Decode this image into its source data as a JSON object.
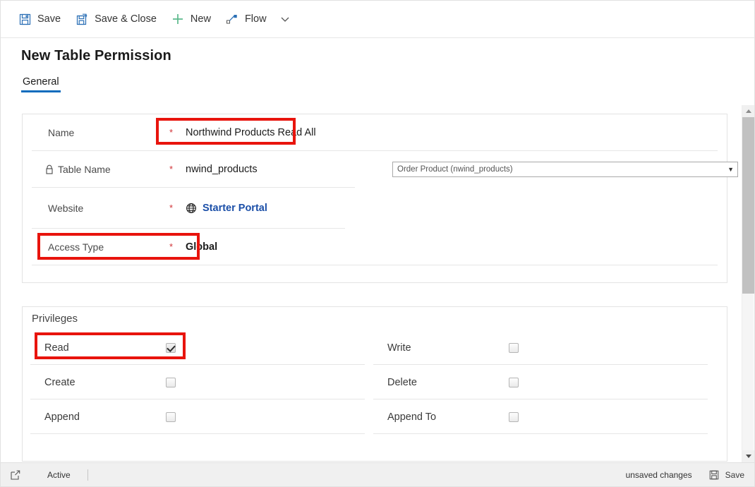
{
  "commandbar": {
    "items": [
      {
        "label": "Save",
        "icon": "save-icon"
      },
      {
        "label": "Save & Close",
        "icon": "save-and-close-icon"
      },
      {
        "label": "New",
        "icon": "plus-icon"
      },
      {
        "label": "Flow",
        "icon": "flow-icon"
      }
    ],
    "overflow_icon": "chevron-down-icon"
  },
  "page": {
    "title": "New Table Permission",
    "tabs": [
      {
        "label": "General",
        "active": true
      }
    ]
  },
  "general": {
    "rows": [
      {
        "label": "Name",
        "required": "*",
        "value": "Northwind Products Read All",
        "lock_icon": false,
        "bold": false,
        "highlighted": true
      },
      {
        "label": "Table Name",
        "required": "*",
        "value": "nwind_products",
        "lock_icon": true,
        "bold": false,
        "highlighted": false,
        "lookup": {
          "value": "Order Product (nwind_products)",
          "caret": "▼"
        }
      },
      {
        "label": "Website",
        "required": "*",
        "value": "Starter Portal",
        "value_is_link": true,
        "globe_icon": true,
        "lock_icon": false,
        "highlighted": false
      },
      {
        "label": "Access Type",
        "required": "*",
        "value": "Global",
        "bold": true,
        "lock_icon": false,
        "highlighted": true
      }
    ]
  },
  "privileges": {
    "title": "Privileges",
    "left_column": [
      {
        "label": "Read",
        "checked": true,
        "highlighted": true
      },
      {
        "label": "Create",
        "checked": false,
        "highlighted": false
      },
      {
        "label": "Append",
        "checked": false,
        "highlighted": false
      }
    ],
    "right_column": [
      {
        "label": "Write",
        "checked": false,
        "highlighted": false
      },
      {
        "label": "Delete",
        "checked": false,
        "highlighted": false
      },
      {
        "label": "Append To",
        "checked": false,
        "highlighted": false
      }
    ]
  },
  "statusbar": {
    "popout_icon": "open-in-new-window-icon",
    "state": "Active",
    "unsaved": "unsaved changes",
    "save_label": "Save",
    "save_icon": "save-icon"
  },
  "colors": {
    "accent": "#0f6cbd",
    "required": "#d13438",
    "highlight": "#e8140d",
    "link": "#1b4fa8"
  }
}
